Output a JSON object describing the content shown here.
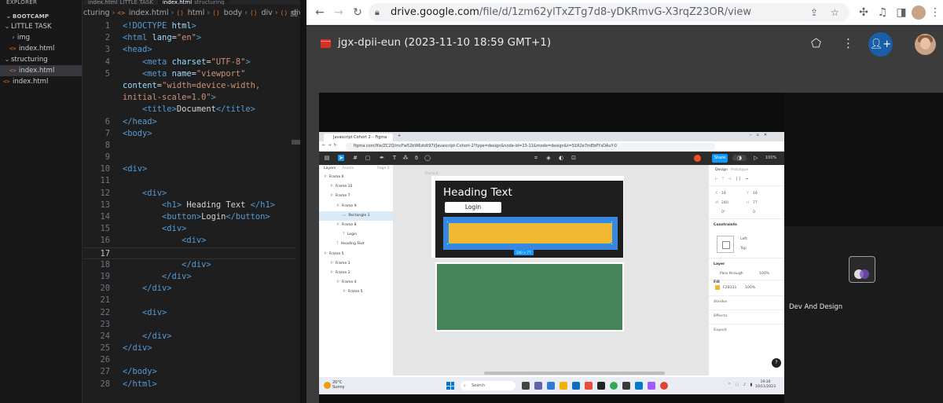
{
  "vscode": {
    "explorer_title": "EXPLORER",
    "section_title": "BOOTCAMP",
    "tree": [
      {
        "label": "LITTLE TASK",
        "type": "folder-open",
        "indent": 0
      },
      {
        "label": "img",
        "type": "folder-closed",
        "indent": 1
      },
      {
        "label": "index.html",
        "type": "file",
        "indent": 1
      },
      {
        "label": "structuring",
        "type": "folder-open",
        "indent": 0
      },
      {
        "label": "index.html",
        "type": "file",
        "indent": 1,
        "selected": true
      },
      {
        "label": "index.html",
        "type": "file",
        "indent": 0
      }
    ],
    "tabs": [
      {
        "label": "index.html",
        "folder": "LITTLE TASK",
        "active": false
      },
      {
        "label": "index.html",
        "folder": "structuring",
        "active": true
      }
    ],
    "breadcrumb": [
      "cturing",
      "index.html",
      "html",
      "body",
      "div",
      "div",
      "div"
    ],
    "current_line": 17,
    "code_lines": [
      {
        "n": "1",
        "tokens": [
          {
            "c": "tg",
            "t": "<!DOCTYPE "
          },
          {
            "c": "at",
            "t": "html"
          },
          {
            "c": "tg",
            "t": ">"
          }
        ]
      },
      {
        "n": "2",
        "tokens": [
          {
            "c": "tg",
            "t": "<html "
          },
          {
            "c": "at",
            "t": "lang"
          },
          {
            "c": "tx",
            "t": "="
          },
          {
            "c": "st",
            "t": "\"en\""
          },
          {
            "c": "tg",
            "t": ">"
          }
        ]
      },
      {
        "n": "3",
        "tokens": [
          {
            "c": "tg",
            "t": "<head>"
          }
        ]
      },
      {
        "n": "4",
        "tokens": [
          {
            "c": "tx",
            "t": "    "
          },
          {
            "c": "tg",
            "t": "<meta "
          },
          {
            "c": "at",
            "t": "charset"
          },
          {
            "c": "tx",
            "t": "="
          },
          {
            "c": "st",
            "t": "\"UTF-8\""
          },
          {
            "c": "tg",
            "t": ">"
          }
        ]
      },
      {
        "n": "5",
        "tokens": [
          {
            "c": "tx",
            "t": "    "
          },
          {
            "c": "tg",
            "t": "<meta "
          },
          {
            "c": "at",
            "t": "name"
          },
          {
            "c": "tx",
            "t": "="
          },
          {
            "c": "st",
            "t": "\"viewport\""
          }
        ]
      },
      {
        "n": "",
        "tokens": [
          {
            "c": "at",
            "t": "content"
          },
          {
            "c": "tx",
            "t": "="
          },
          {
            "c": "st",
            "t": "\"width=device-width,"
          }
        ]
      },
      {
        "n": "",
        "tokens": [
          {
            "c": "st",
            "t": "initial-scale=1.0\""
          },
          {
            "c": "tg",
            "t": ">"
          }
        ]
      },
      {
        "n": "",
        "tokens": [
          {
            "c": "tx",
            "t": "    "
          },
          {
            "c": "tg",
            "t": "<title>"
          },
          {
            "c": "tx",
            "t": "Document"
          },
          {
            "c": "tg",
            "t": "</title>"
          }
        ]
      },
      {
        "n": "6",
        "tokens": [
          {
            "c": "tg",
            "t": "</head>"
          }
        ]
      },
      {
        "n": "7",
        "tokens": [
          {
            "c": "tg",
            "t": "<body>"
          }
        ]
      },
      {
        "n": "8",
        "tokens": []
      },
      {
        "n": "9",
        "tokens": []
      },
      {
        "n": "10",
        "tokens": [
          {
            "c": "tg",
            "t": "<div>"
          }
        ]
      },
      {
        "n": "11",
        "tokens": []
      },
      {
        "n": "12",
        "tokens": [
          {
            "c": "tx",
            "t": "    "
          },
          {
            "c": "tg",
            "t": "<div>"
          }
        ]
      },
      {
        "n": "13",
        "tokens": [
          {
            "c": "tx",
            "t": "        "
          },
          {
            "c": "tg",
            "t": "<h1>"
          },
          {
            "c": "tx",
            "t": " Heading Text "
          },
          {
            "c": "tg",
            "t": "</h1>"
          }
        ]
      },
      {
        "n": "14",
        "tokens": [
          {
            "c": "tx",
            "t": "        "
          },
          {
            "c": "tg",
            "t": "<button>"
          },
          {
            "c": "tx",
            "t": "Login"
          },
          {
            "c": "tg",
            "t": "</button>"
          }
        ]
      },
      {
        "n": "15",
        "tokens": [
          {
            "c": "tx",
            "t": "        "
          },
          {
            "c": "tg",
            "t": "<div>"
          }
        ]
      },
      {
        "n": "16",
        "tokens": [
          {
            "c": "tx",
            "t": "            "
          },
          {
            "c": "tg",
            "t": "<div>"
          }
        ]
      },
      {
        "n": "17",
        "tokens": []
      },
      {
        "n": "18",
        "tokens": [
          {
            "c": "tx",
            "t": "            "
          },
          {
            "c": "tg",
            "t": "</div>"
          }
        ]
      },
      {
        "n": "19",
        "tokens": [
          {
            "c": "tx",
            "t": "        "
          },
          {
            "c": "tg",
            "t": "</div>"
          }
        ]
      },
      {
        "n": "20",
        "tokens": [
          {
            "c": "tx",
            "t": "    "
          },
          {
            "c": "tg",
            "t": "</div>"
          }
        ]
      },
      {
        "n": "21",
        "tokens": []
      },
      {
        "n": "22",
        "tokens": [
          {
            "c": "tx",
            "t": "    "
          },
          {
            "c": "tg",
            "t": "<div>"
          }
        ]
      },
      {
        "n": "23",
        "tokens": []
      },
      {
        "n": "24",
        "tokens": [
          {
            "c": "tx",
            "t": "    "
          },
          {
            "c": "tg",
            "t": "</div>"
          }
        ]
      },
      {
        "n": "25",
        "tokens": [
          {
            "c": "tg",
            "t": "</div>"
          }
        ]
      },
      {
        "n": "26",
        "tokens": []
      },
      {
        "n": "27",
        "tokens": [
          {
            "c": "tg",
            "t": "</body>"
          }
        ]
      },
      {
        "n": "28",
        "tokens": [
          {
            "c": "tg",
            "t": "</html>"
          }
        ]
      }
    ]
  },
  "chrome": {
    "url_domain": "drive.google.com",
    "url_path": "/file/d/1zm62ylTxZTg7d8-yDKRmvG-X3rqZ23OR/view",
    "file_title": "jgx-dpii-eun (2023-11-10 18:59 GMT+1)"
  },
  "video": {
    "figma_tab_title": "Javascript Cohort 2 – Figma",
    "figma_url": "figma.com/file/ZC2Q/mcFw52bW6ztdt97I/Javascript-Cohort-2?type=design&node-id=23-11&mode=design&t=S1R2e7mEbPYxDAuY-0",
    "layers_tab": "Layers",
    "assets_tab": "Assets",
    "page_label": "Page 2",
    "canvas_label": "Frame 6",
    "layers": [
      {
        "label": "Frame 6",
        "indent": 0,
        "glyph": "#"
      },
      {
        "label": "Frame 10",
        "indent": 1,
        "glyph": "#"
      },
      {
        "label": "Frame 7",
        "indent": 1,
        "glyph": "#"
      },
      {
        "label": "Frame 9",
        "indent": 2,
        "glyph": "#"
      },
      {
        "label": "Rectangle 1",
        "indent": 3,
        "glyph": "▭",
        "selected": true
      },
      {
        "label": "Frame 8",
        "indent": 2,
        "glyph": "#"
      },
      {
        "label": "Login",
        "indent": 3,
        "glyph": "T"
      },
      {
        "label": "Heading Text",
        "indent": 2,
        "glyph": "T"
      },
      {
        "label": "Frame 5",
        "indent": 0,
        "glyph": "#"
      },
      {
        "label": "Frame 3",
        "indent": 1,
        "glyph": "#"
      },
      {
        "label": "Frame 2",
        "indent": 1,
        "glyph": "#"
      },
      {
        "label": "Frame 4",
        "indent": 2,
        "glyph": "#"
      },
      {
        "label": "Frame 5",
        "indent": 3,
        "glyph": "#"
      }
    ],
    "heading_text": "Heading Text",
    "login_text": "Login",
    "dimension_badge": "240 × 77",
    "share_label": "Share",
    "zoom_label": "100%",
    "props": {
      "design_tab": "Design",
      "prototype_tab": "Prototype",
      "x": "16",
      "y": "16",
      "w": "240",
      "h": "77",
      "rotation": "0°",
      "radius": "0",
      "constraints_title": "Constraints",
      "constraint_h": "Left",
      "constraint_v": "Top",
      "layer_title": "Layer",
      "blend": "Pass through",
      "opacity": "100%",
      "fill_title": "Fill",
      "fill_hex": "F2B331",
      "fill_opacity": "100%",
      "stroke_title": "Stroke",
      "effects_title": "Effects",
      "export_title": "Export"
    },
    "weather_temp": "20°C",
    "weather_desc": "Sunny",
    "search_label": "Search",
    "clock_time": "19:30",
    "clock_date": "10/11/2023",
    "dev_label": "Dev And Design",
    "help_label": "?"
  },
  "colors": {
    "drive_share": "#1a5ea8",
    "figma_blue": "#0d99ff",
    "fill_yellow": "#f2b831",
    "green_frame": "#46845a",
    "pdf_red": "#d93025"
  }
}
